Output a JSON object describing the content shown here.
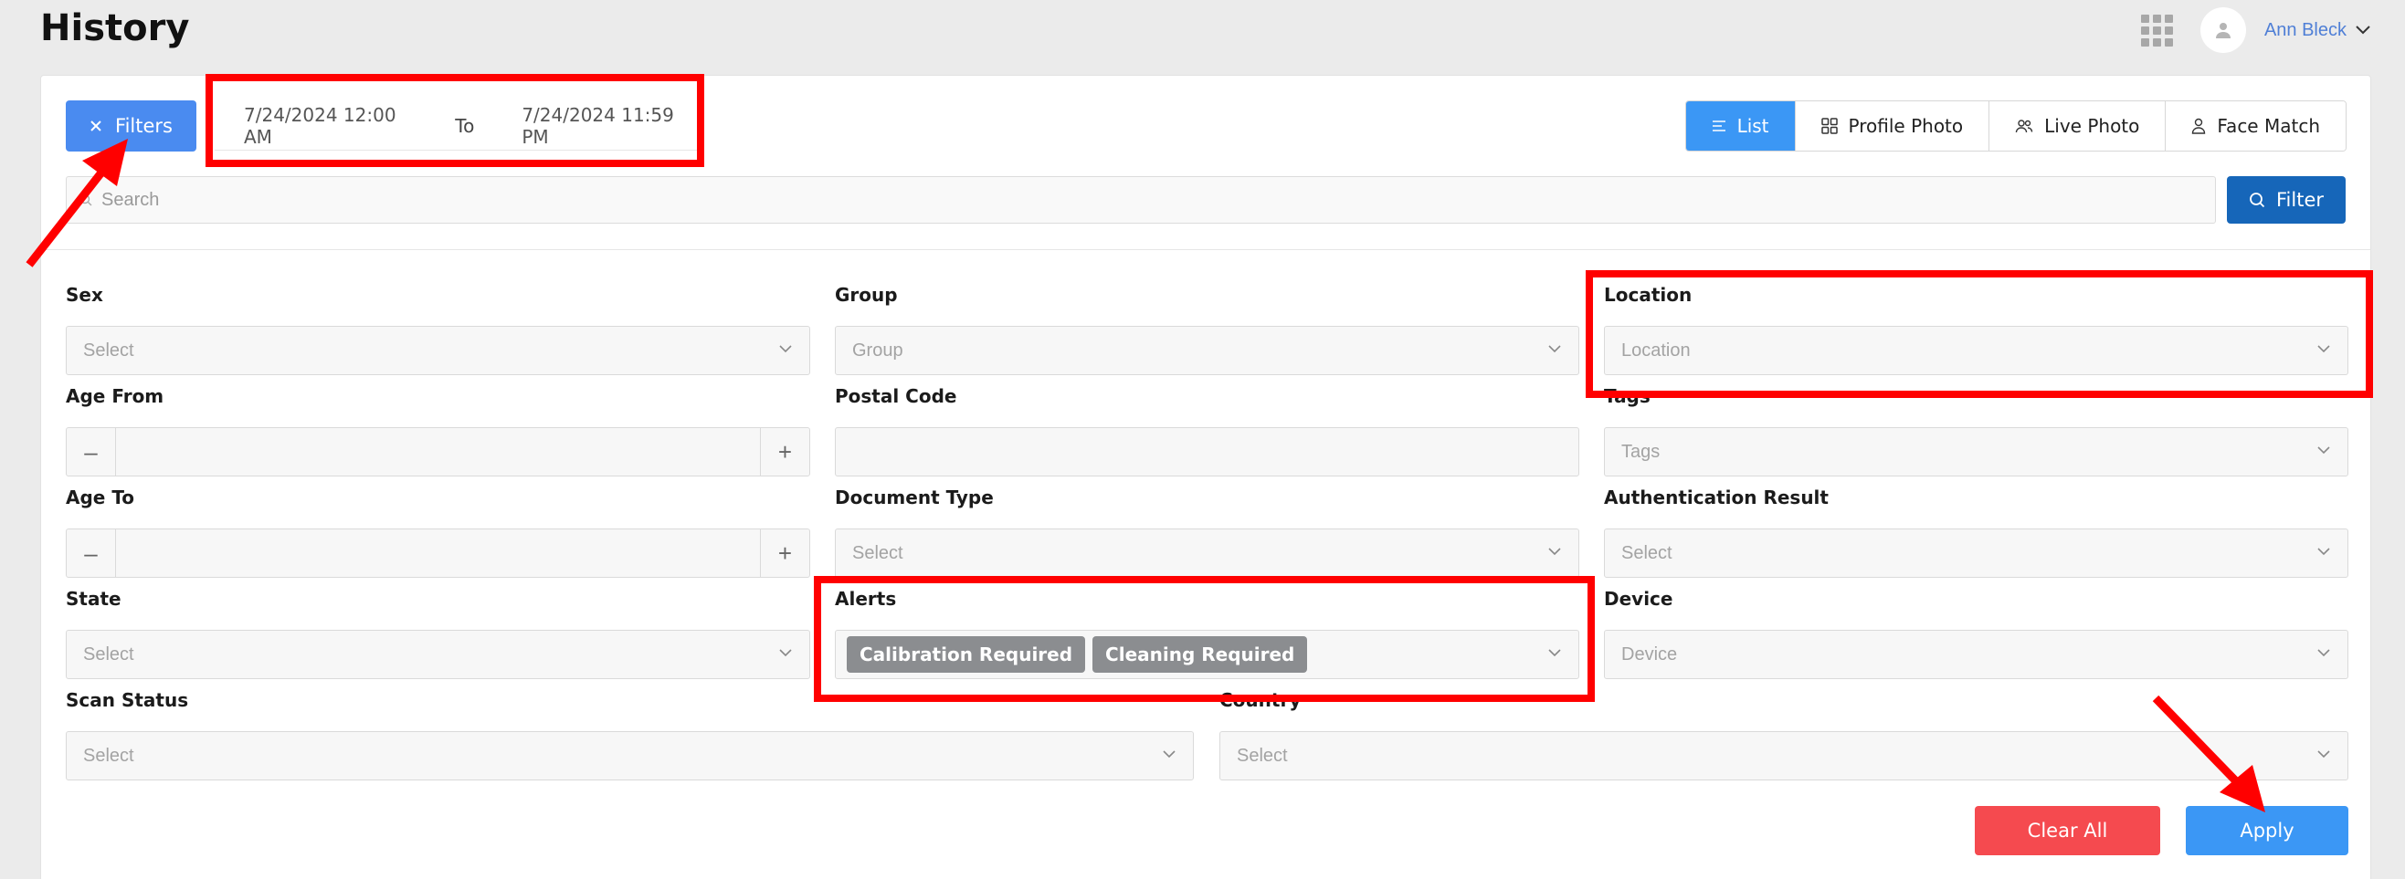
{
  "page": {
    "title": "History"
  },
  "user": {
    "name": "Ann Bleck"
  },
  "toolbar": {
    "filters_label": "Filters",
    "date_from": "7/24/2024 12:00 AM",
    "date_to_sep": "To",
    "date_to": "7/24/2024 11:59 PM",
    "views": [
      {
        "label": "List",
        "icon": "list-icon",
        "active": true
      },
      {
        "label": "Profile Photo",
        "icon": "grid-icon",
        "active": false
      },
      {
        "label": "Live Photo",
        "icon": "people-icon",
        "active": false
      },
      {
        "label": "Face Match",
        "icon": "person-icon",
        "active": false
      }
    ]
  },
  "search": {
    "placeholder": "Search",
    "button_label": "Filter"
  },
  "filters": {
    "sex": {
      "label": "Sex",
      "placeholder": "Select"
    },
    "group": {
      "label": "Group",
      "placeholder": "Group"
    },
    "location": {
      "label": "Location",
      "placeholder": "Location"
    },
    "age_from": {
      "label": "Age From"
    },
    "postal_code": {
      "label": "Postal Code"
    },
    "tags": {
      "label": "Tags",
      "placeholder": "Tags"
    },
    "age_to": {
      "label": "Age To"
    },
    "document_type": {
      "label": "Document Type",
      "placeholder": "Select"
    },
    "authentication_result": {
      "label": "Authentication Result",
      "placeholder": "Select"
    },
    "state": {
      "label": "State",
      "placeholder": "Select"
    },
    "alerts": {
      "label": "Alerts",
      "selected": [
        "Calibration Required",
        "Cleaning Required"
      ]
    },
    "device": {
      "label": "Device",
      "placeholder": "Device"
    },
    "scan_status": {
      "label": "Scan Status",
      "placeholder": "Select"
    },
    "country": {
      "label": "Country",
      "placeholder": "Select"
    }
  },
  "actions": {
    "clear_label": "Clear All",
    "apply_label": "Apply"
  },
  "colors": {
    "primary": "#3b97f5",
    "filter_dark": "#1666b9",
    "danger": "#f54a4f",
    "annotation": "#ff0000"
  }
}
